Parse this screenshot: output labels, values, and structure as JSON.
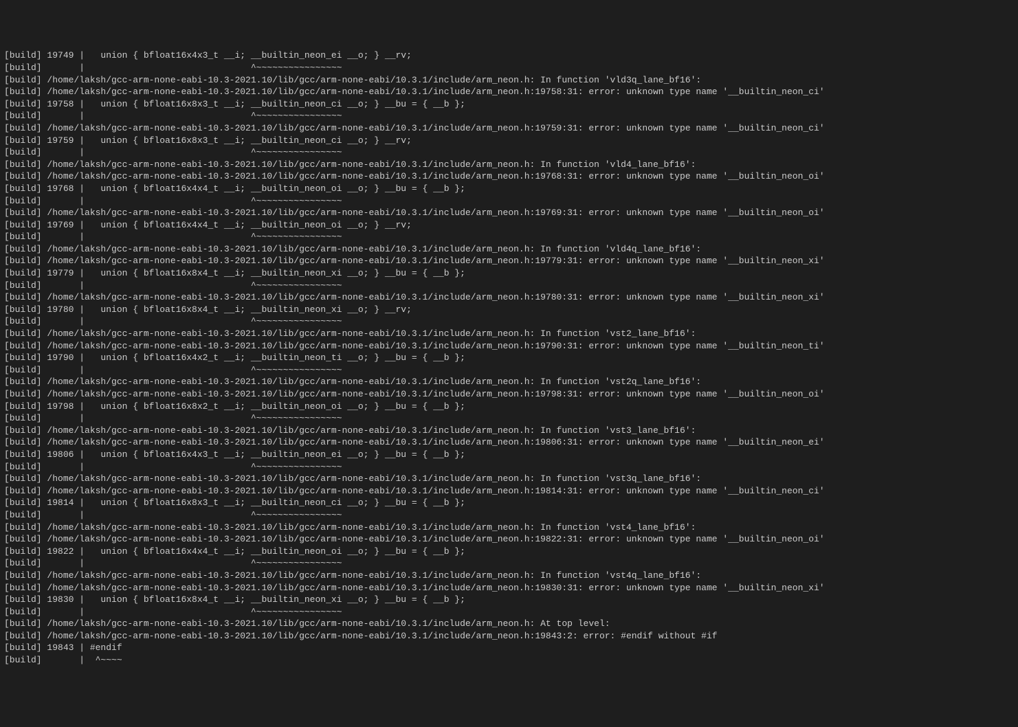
{
  "terminal": {
    "prefix": "[build] ",
    "lines": [
      "19749 |   union { bfloat16x4x3_t __i; __builtin_neon_ei __o; } __rv;",
      "      |                               ^~~~~~~~~~~~~~~~~",
      "/home/laksh/gcc-arm-none-eabi-10.3-2021.10/lib/gcc/arm-none-eabi/10.3.1/include/arm_neon.h: In function 'vld3q_lane_bf16':",
      "/home/laksh/gcc-arm-none-eabi-10.3-2021.10/lib/gcc/arm-none-eabi/10.3.1/include/arm_neon.h:19758:31: error: unknown type name '__builtin_neon_ci'",
      "19758 |   union { bfloat16x8x3_t __i; __builtin_neon_ci __o; } __bu = { __b };",
      "      |                               ^~~~~~~~~~~~~~~~~",
      "/home/laksh/gcc-arm-none-eabi-10.3-2021.10/lib/gcc/arm-none-eabi/10.3.1/include/arm_neon.h:19759:31: error: unknown type name '__builtin_neon_ci'",
      "19759 |   union { bfloat16x8x3_t __i; __builtin_neon_ci __o; } __rv;",
      "      |                               ^~~~~~~~~~~~~~~~~",
      "/home/laksh/gcc-arm-none-eabi-10.3-2021.10/lib/gcc/arm-none-eabi/10.3.1/include/arm_neon.h: In function 'vld4_lane_bf16':",
      "/home/laksh/gcc-arm-none-eabi-10.3-2021.10/lib/gcc/arm-none-eabi/10.3.1/include/arm_neon.h:19768:31: error: unknown type name '__builtin_neon_oi'",
      "19768 |   union { bfloat16x4x4_t __i; __builtin_neon_oi __o; } __bu = { __b };",
      "      |                               ^~~~~~~~~~~~~~~~~",
      "/home/laksh/gcc-arm-none-eabi-10.3-2021.10/lib/gcc/arm-none-eabi/10.3.1/include/arm_neon.h:19769:31: error: unknown type name '__builtin_neon_oi'",
      "19769 |   union { bfloat16x4x4_t __i; __builtin_neon_oi __o; } __rv;",
      "      |                               ^~~~~~~~~~~~~~~~~",
      "/home/laksh/gcc-arm-none-eabi-10.3-2021.10/lib/gcc/arm-none-eabi/10.3.1/include/arm_neon.h: In function 'vld4q_lane_bf16':",
      "/home/laksh/gcc-arm-none-eabi-10.3-2021.10/lib/gcc/arm-none-eabi/10.3.1/include/arm_neon.h:19779:31: error: unknown type name '__builtin_neon_xi'",
      "19779 |   union { bfloat16x8x4_t __i; __builtin_neon_xi __o; } __bu = { __b };",
      "      |                               ^~~~~~~~~~~~~~~~~",
      "/home/laksh/gcc-arm-none-eabi-10.3-2021.10/lib/gcc/arm-none-eabi/10.3.1/include/arm_neon.h:19780:31: error: unknown type name '__builtin_neon_xi'",
      "19780 |   union { bfloat16x8x4_t __i; __builtin_neon_xi __o; } __rv;",
      "      |                               ^~~~~~~~~~~~~~~~~",
      "/home/laksh/gcc-arm-none-eabi-10.3-2021.10/lib/gcc/arm-none-eabi/10.3.1/include/arm_neon.h: In function 'vst2_lane_bf16':",
      "/home/laksh/gcc-arm-none-eabi-10.3-2021.10/lib/gcc/arm-none-eabi/10.3.1/include/arm_neon.h:19790:31: error: unknown type name '__builtin_neon_ti'",
      "19790 |   union { bfloat16x4x2_t __i; __builtin_neon_ti __o; } __bu = { __b };",
      "      |                               ^~~~~~~~~~~~~~~~~",
      "/home/laksh/gcc-arm-none-eabi-10.3-2021.10/lib/gcc/arm-none-eabi/10.3.1/include/arm_neon.h: In function 'vst2q_lane_bf16':",
      "/home/laksh/gcc-arm-none-eabi-10.3-2021.10/lib/gcc/arm-none-eabi/10.3.1/include/arm_neon.h:19798:31: error: unknown type name '__builtin_neon_oi'",
      "19798 |   union { bfloat16x8x2_t __i; __builtin_neon_oi __o; } __bu = { __b };",
      "      |                               ^~~~~~~~~~~~~~~~~",
      "/home/laksh/gcc-arm-none-eabi-10.3-2021.10/lib/gcc/arm-none-eabi/10.3.1/include/arm_neon.h: In function 'vst3_lane_bf16':",
      "/home/laksh/gcc-arm-none-eabi-10.3-2021.10/lib/gcc/arm-none-eabi/10.3.1/include/arm_neon.h:19806:31: error: unknown type name '__builtin_neon_ei'",
      "19806 |   union { bfloat16x4x3_t __i; __builtin_neon_ei __o; } __bu = { __b };",
      "      |                               ^~~~~~~~~~~~~~~~~",
      "/home/laksh/gcc-arm-none-eabi-10.3-2021.10/lib/gcc/arm-none-eabi/10.3.1/include/arm_neon.h: In function 'vst3q_lane_bf16':",
      "/home/laksh/gcc-arm-none-eabi-10.3-2021.10/lib/gcc/arm-none-eabi/10.3.1/include/arm_neon.h:19814:31: error: unknown type name '__builtin_neon_ci'",
      "19814 |   union { bfloat16x8x3_t __i; __builtin_neon_ci __o; } __bu = { __b };",
      "      |                               ^~~~~~~~~~~~~~~~~",
      "/home/laksh/gcc-arm-none-eabi-10.3-2021.10/lib/gcc/arm-none-eabi/10.3.1/include/arm_neon.h: In function 'vst4_lane_bf16':",
      "/home/laksh/gcc-arm-none-eabi-10.3-2021.10/lib/gcc/arm-none-eabi/10.3.1/include/arm_neon.h:19822:31: error: unknown type name '__builtin_neon_oi'",
      "19822 |   union { bfloat16x4x4_t __i; __builtin_neon_oi __o; } __bu = { __b };",
      "      |                               ^~~~~~~~~~~~~~~~~",
      "/home/laksh/gcc-arm-none-eabi-10.3-2021.10/lib/gcc/arm-none-eabi/10.3.1/include/arm_neon.h: In function 'vst4q_lane_bf16':",
      "/home/laksh/gcc-arm-none-eabi-10.3-2021.10/lib/gcc/arm-none-eabi/10.3.1/include/arm_neon.h:19830:31: error: unknown type name '__builtin_neon_xi'",
      "19830 |   union { bfloat16x8x4_t __i; __builtin_neon_xi __o; } __bu = { __b };",
      "      |                               ^~~~~~~~~~~~~~~~~",
      "/home/laksh/gcc-arm-none-eabi-10.3-2021.10/lib/gcc/arm-none-eabi/10.3.1/include/arm_neon.h: At top level:",
      "/home/laksh/gcc-arm-none-eabi-10.3-2021.10/lib/gcc/arm-none-eabi/10.3.1/include/arm_neon.h:19843:2: error: #endif without #if",
      "19843 | #endif",
      "      |  ^~~~~"
    ]
  }
}
